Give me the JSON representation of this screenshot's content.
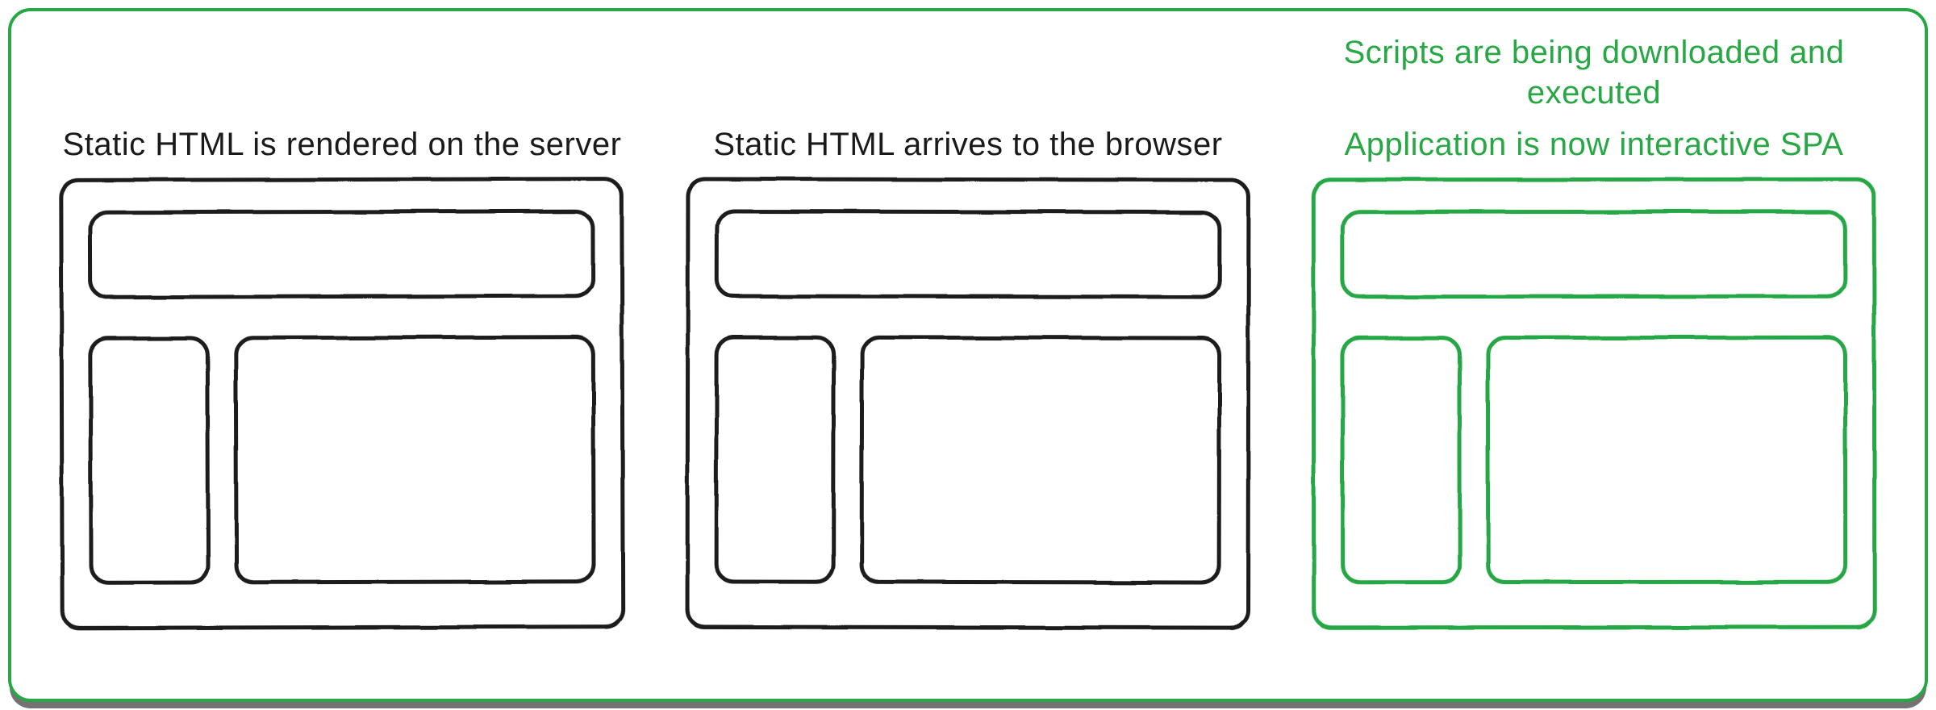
{
  "panels": [
    {
      "captions": [
        "Static HTML is rendered on the server"
      ],
      "caption_color": "black",
      "wireframe_color": "black"
    },
    {
      "captions": [
        "Static HTML arrives to the browser"
      ],
      "caption_color": "black",
      "wireframe_color": "black"
    },
    {
      "captions": [
        "Scripts are being downloaded and executed",
        "Application is now interactive SPA"
      ],
      "caption_color": "green",
      "wireframe_color": "green"
    }
  ],
  "colors": {
    "black": "#1a1a1a",
    "green": "#28a745"
  }
}
